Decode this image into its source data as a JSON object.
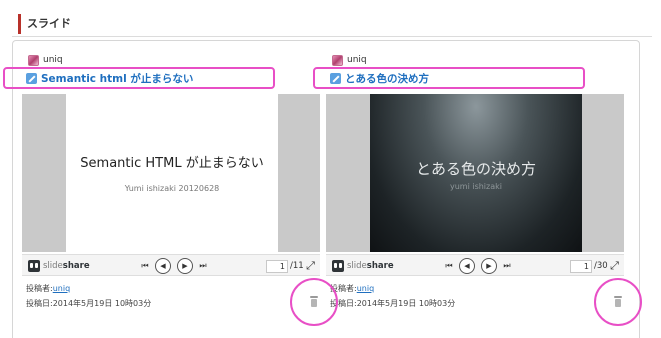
{
  "section": {
    "title": "スライド"
  },
  "cards": [
    {
      "author": "uniq",
      "title": "Semantic html が止まらない",
      "slide_title": "Semantic HTML が止まらない",
      "slide_subtitle": "Yumi ishizaki 20120628",
      "page_current": "1",
      "page_total": "/11",
      "poster_label": "投稿者:",
      "poster_name": "uniq",
      "posted_date": "投稿日:2014年5月19日 10時03分"
    },
    {
      "author": "uniq",
      "title": "とある色の決め方",
      "slide_title": "とある色の決め方",
      "slide_subtitle": "yumi ishizaki",
      "page_current": "1",
      "page_total": "/30",
      "poster_label": "投稿者:",
      "poster_name": "uniq",
      "posted_date": "投稿日:2014年5月19日 10時03分"
    }
  ],
  "player": {
    "brand_light": "slide",
    "brand_bold": "share",
    "first_glyph": "⏮",
    "prev_glyph": "◀",
    "play_glyph": "▶",
    "last_glyph": "⏭",
    "fullscreen_glyph": "⤢"
  },
  "colors": {
    "accent_link": "#1f6fbf",
    "highlight": "#e84fc6",
    "section_bar": "#b8312a"
  }
}
